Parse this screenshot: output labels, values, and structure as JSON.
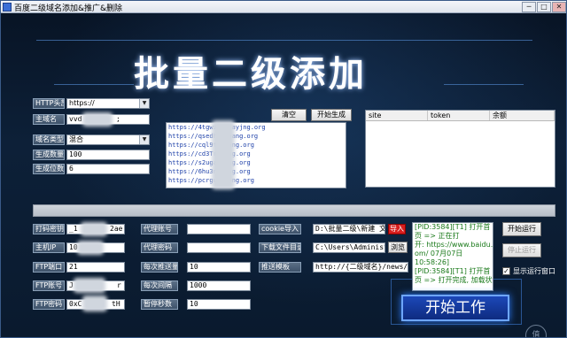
{
  "window": {
    "title": "百度二级域名添加&推广&删除",
    "btn_min": "─",
    "btn_max": "□",
    "btn_close": "✕"
  },
  "banner": {
    "text": "批量二级添加"
  },
  "left_form": {
    "http_head_label": "HTTP头部",
    "http_head_value": "https://",
    "main_domain_label": "主域名",
    "main_domain_value": "vvd",
    "main_domain_suffix": ";",
    "domain_type_label": "域名类型",
    "domain_type_value": "混合",
    "gen_count_label": "生成数量",
    "gen_count_value": "100",
    "gen_digits_label": "生成位数",
    "gen_digits_value": "6"
  },
  "url_controls": {
    "clear_label": "清空",
    "start_generate_label": "开始生成"
  },
  "url_list": [
    "https://4tgwzq.v  ayjng.org",
    "https://qsedhf.  nang.org",
    "https://cql9ts.  ang.org",
    "https://cd3Trv.  ng.org",
    "https://s2ugai.  ng.org",
    "https://6hu3nm.  ng.org",
    "https://pcrgu8.  ang.org"
  ],
  "table": {
    "columns": [
      "site",
      "token",
      "余额"
    ]
  },
  "bottom_form": {
    "pack_key_label": "打码密钥",
    "pack_key_value": "_1",
    "pack_key_suffix": "2ae",
    "proxy_account_label": "代理账号",
    "host_ip_label": "主机IP",
    "host_ip_value": "10",
    "proxy_pwd_label": "代理密码",
    "ftp_port_label": "FTP端口",
    "ftp_port_value": "21",
    "interval_label": "每次推送量",
    "interval_value": "10",
    "ftp_account_label": "FTP账号",
    "ftp_account_value": "J",
    "ftp_account_suffix": "r",
    "each_interval_label": "每次间隔",
    "each_interval_value": "1000",
    "ftp_pwd_label": "FTP密码",
    "ftp_pwd_value": "0xC",
    "ftp_pwd_suffix": "tH",
    "pause_seconds_label": "暂停秒数",
    "pause_seconds_value": "10",
    "cookie_import_label": "cookie导入",
    "cookie_import_value": "D:\\批量二级\\新建 文本",
    "import_btn_label": "导入",
    "download_dir_label": "下载文件目录",
    "download_dir_value": "C:\\Users\\Administrato",
    "browse_btn_label": "浏览",
    "push_template_label": "推送模板",
    "push_template_value": "http://{二级域名}/news/{随机数}"
  },
  "log_lines": [
    "[PID:3584][T1] 打开首",
    "页 => 正在打",
    "开: https://www.baidu.c",
    "om/ 07月07日",
    "10:58:26]",
    "[PID:3584][T1] 打开首",
    "页 => 打开完成, 加载状"
  ],
  "controls": {
    "start_run_label": "开始运行",
    "stop_run_label": "停止运行",
    "show_window_label": "显示运行窗口",
    "show_window_checked": "✓",
    "start_work_label": "开始工作"
  },
  "watermark": "值"
}
